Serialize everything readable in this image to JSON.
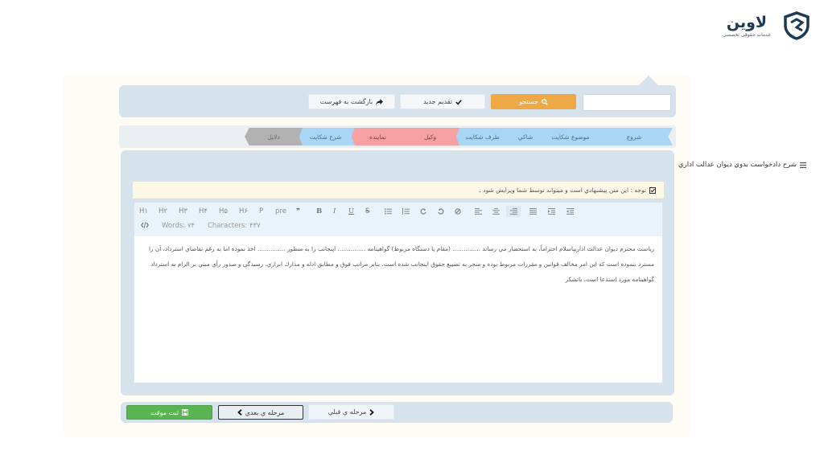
{
  "brand": {
    "name": "لاوین",
    "tagline": "خدمات حقوقی تخصصی"
  },
  "topbar": {
    "search_input_value": "",
    "search_label": "جستجو",
    "new_submission_label": "تقديم جديد",
    "back_to_list_label": "بازگشت به فهرست",
    "search_color": "#eea845"
  },
  "steps": [
    {
      "label": "شروع",
      "status": "blue"
    },
    {
      "label": "موضوع شکايت",
      "status": "blue"
    },
    {
      "label": "شاکي",
      "status": "blue"
    },
    {
      "label": "طرف شکايت",
      "status": "blue"
    },
    {
      "label": "وکيل",
      "status": "red"
    },
    {
      "label": "نماينده",
      "status": "red"
    },
    {
      "label": "شرح شکايت",
      "status": "blue"
    },
    {
      "label": "دلايل",
      "status": "gray"
    }
  ],
  "section": {
    "title": "شرح دادخواست بدوي ديوان عدالت اداري",
    "notice": "توجه : اين متن پيشنهادي است و ميتواند توسط شما ويرايش شود ."
  },
  "editor": {
    "toolbar": {
      "h1": "H۱",
      "h2": "H۲",
      "h3": "H۳",
      "h4": "H۴",
      "h5": "H۵",
      "h6": "H۶",
      "p": "P",
      "pre": "pre",
      "quote": "❞",
      "bold": "B",
      "italic": "I",
      "underline": "U",
      "strike": "S"
    },
    "words": "Words: ۷۴",
    "characters": "Characters: ۴۳۷",
    "content_lines": [
      "رياست محترم ديوان عدالت اداريباسلام احتراماً، به استحضار مي رساند ............... (مقام يا دستگاه مربوط) گواهينامه ............... اينجانب را به منظور ............... اخذ نموده اما به رغم تقاضاي استرداد، آن را",
      "مسترد ننموده است که اين امر مخالف قوانين و مقررات مربوط بوده و منجر به تضييع حقوق اينجانب شده است. بنابر مراتب فوق و مطابق ادله و مدارك ابرازي، رسيدگي و صدور رأي مبني بر الزام به استرداد",
      "گواهينامه مورد استدعا است. باتشکر"
    ]
  },
  "bottom": {
    "save_draft_label": "ثبت موقت",
    "next_label": "مرحله ي بعدي",
    "prev_label": "مرحله ي قبلي"
  }
}
